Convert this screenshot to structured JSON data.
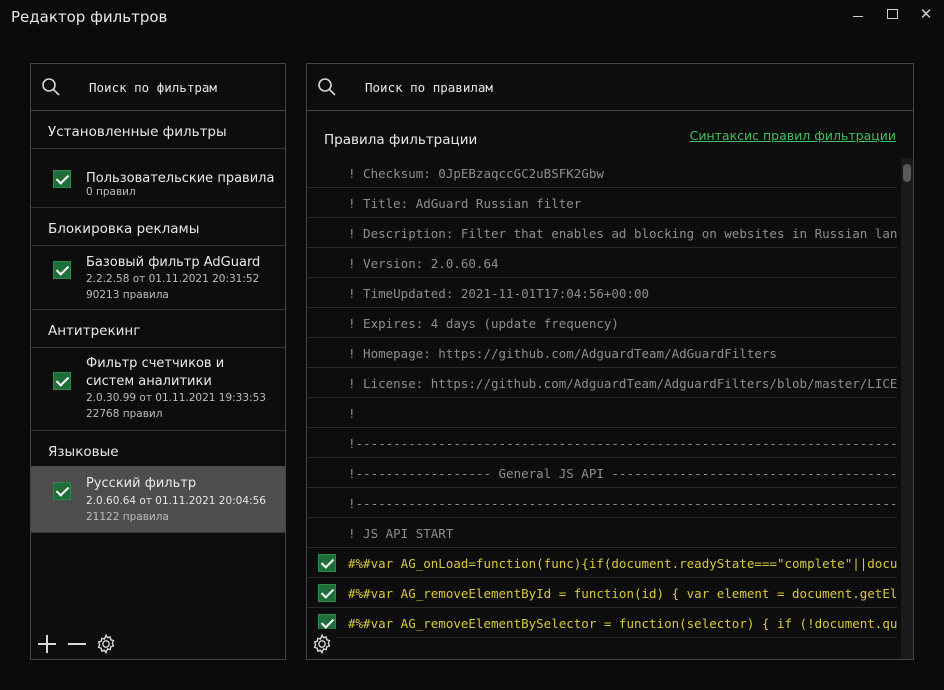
{
  "window": {
    "title": "Редактор фильтров",
    "close_glyph": "✕"
  },
  "filters_panel": {
    "search_placeholder": "Поиск по фильтрам",
    "groups": [
      {
        "label": "Установленные фильтры",
        "items": [
          {
            "name": "Пользовательские правила",
            "version": "",
            "rules": "0 правил",
            "enabled": true
          }
        ]
      },
      {
        "label": "Блокировка рекламы",
        "items": [
          {
            "name": "Базовый фильтр AdGuard",
            "version": "2.2.2.58 от 01.11.2021 20:31:52",
            "rules": "90213 правила",
            "enabled": true
          }
        ]
      },
      {
        "label": "Антитрекинг",
        "items": [
          {
            "name": "Фильтр счетчиков и систем аналитики",
            "version": "2.0.30.99 от 01.11.2021 19:33:53",
            "rules": "22768 правил",
            "enabled": true
          }
        ]
      },
      {
        "label": "Языковые",
        "items": [
          {
            "name": "Русский фильтр",
            "version": "2.0.60.64 от 01.11.2021 20:04:56",
            "rules": "21122 правила",
            "enabled": true,
            "selected": true
          }
        ]
      }
    ],
    "footer_icons": [
      "plus-icon",
      "minus-icon",
      "gear-icon"
    ]
  },
  "rules_panel": {
    "search_placeholder": "Поиск по правилам",
    "title": "Правила фильтрации",
    "syntax_link": "Синтаксис правил фильтрации",
    "rules": [
      {
        "text": "! Checksum: 0JpEBzaqccGC2uBSFK2Gbw",
        "checkbox": false
      },
      {
        "text": "! Title: AdGuard Russian filter",
        "checkbox": false
      },
      {
        "text": "! Description: Filter that enables ad blocking on websites in Russian lang",
        "checkbox": false
      },
      {
        "text": "! Version: 2.0.60.64",
        "checkbox": false
      },
      {
        "text": "! TimeUpdated: 2021-11-01T17:04:56+00:00",
        "checkbox": false
      },
      {
        "text": "! Expires: 4 days (update frequency)",
        "checkbox": false
      },
      {
        "text": "! Homepage: https://github.com/AdguardTeam/AdGuardFilters",
        "checkbox": false
      },
      {
        "text": "! License: https://github.com/AdguardTeam/AdguardFilters/blob/master/LICEN",
        "checkbox": false
      },
      {
        "text": "!",
        "checkbox": false
      },
      {
        "text": "!------------------------------------------------------------------------------",
        "checkbox": false
      },
      {
        "text": "!------------------ General JS API ---------------------------------------------",
        "checkbox": false
      },
      {
        "text": "!------------------------------------------------------------------------------",
        "checkbox": false
      },
      {
        "text": "! JS API START",
        "checkbox": false
      },
      {
        "text": "#%#var AG_onLoad=function(func){if(document.readyState===\"complete\"||docum",
        "checkbox": true
      },
      {
        "text": "#%#var AG_removeElementById = function(id) { var element = document.getEle",
        "checkbox": true
      },
      {
        "text": "#%#var AG_removeElementBySelector = function(selector) { if (!document.que",
        "checkbox": true
      }
    ]
  },
  "colors": {
    "accent": "#3fbf5f",
    "checkbox": "#1e6e3a",
    "selected_row": "#4d4d4d",
    "rule_text": "#d8c93a"
  }
}
